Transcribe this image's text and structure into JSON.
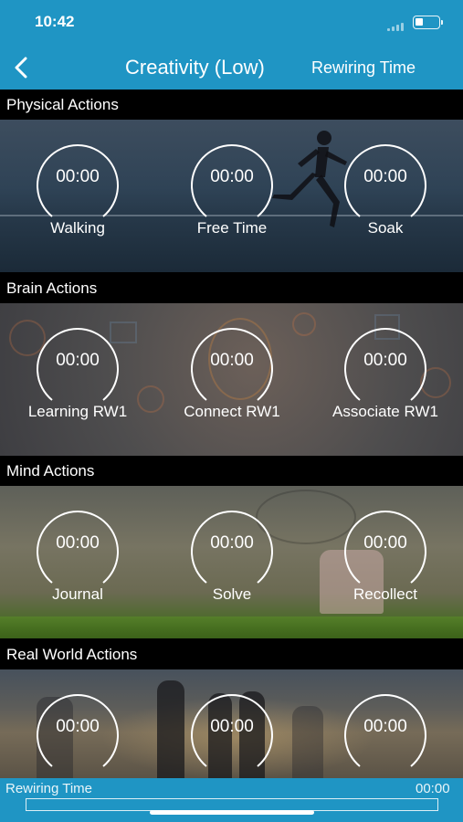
{
  "status_bar": {
    "time": "10:42",
    "battery_level": 0.35
  },
  "nav": {
    "back_icon": "chevron-left-icon",
    "title": "Creativity (Low)",
    "right_label": "Rewiring Time"
  },
  "sections": [
    {
      "title": "Physical Actions",
      "timers": [
        {
          "value": "00:00",
          "label": "Walking"
        },
        {
          "value": "00:00",
          "label": "Free Time"
        },
        {
          "value": "00:00",
          "label": "Soak"
        }
      ]
    },
    {
      "title": "Brain Actions",
      "timers": [
        {
          "value": "00:00",
          "label": "Learning RW1"
        },
        {
          "value": "00:00",
          "label": "Connect RW1"
        },
        {
          "value": "00:00",
          "label": "Associate RW1"
        }
      ]
    },
    {
      "title": "Mind Actions",
      "timers": [
        {
          "value": "00:00",
          "label": "Journal"
        },
        {
          "value": "00:00",
          "label": "Solve"
        },
        {
          "value": "00:00",
          "label": "Recollect"
        }
      ]
    },
    {
      "title": "Real World Actions",
      "timers": [
        {
          "value": "00:00",
          "label": ""
        },
        {
          "value": "00:00",
          "label": ""
        },
        {
          "value": "00:00",
          "label": ""
        }
      ]
    }
  ],
  "bottom_bar": {
    "label": "Rewiring Time",
    "time": "00:00",
    "progress": 0
  },
  "colors": {
    "accent": "#1f95c4",
    "header_bg": "#000000",
    "text": "#ffffff"
  }
}
